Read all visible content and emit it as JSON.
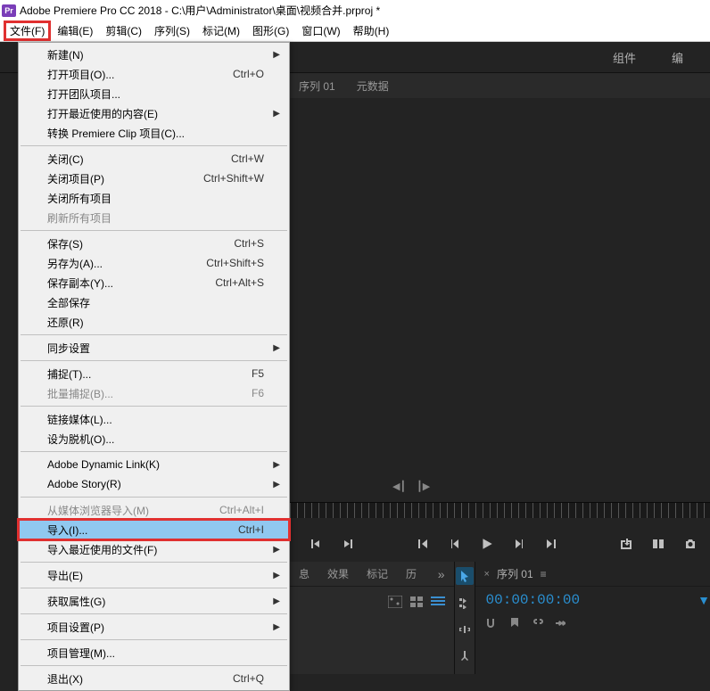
{
  "title": {
    "app_icon": "Pr",
    "text": "Adobe Premiere Pro CC 2018 - C:\\用户\\Administrator\\桌面\\视频合并.prproj *"
  },
  "menu_bar": [
    {
      "label": "文件(F)",
      "highlighted": true
    },
    {
      "label": "编辑(E)"
    },
    {
      "label": "剪辑(C)"
    },
    {
      "label": "序列(S)"
    },
    {
      "label": "标记(M)"
    },
    {
      "label": "图形(G)"
    },
    {
      "label": "窗口(W)"
    },
    {
      "label": "帮助(H)"
    }
  ],
  "workspace_tabs": [
    {
      "label": "组件"
    },
    {
      "label": "编"
    }
  ],
  "panel_tabs": [
    {
      "label": "序列 01"
    },
    {
      "label": "元数据"
    }
  ],
  "lower_tabs": [
    {
      "label": "息"
    },
    {
      "label": "效果"
    },
    {
      "label": "标记"
    },
    {
      "label": "历"
    }
  ],
  "timeline": {
    "title": "序列 01",
    "timecode": "00:00:00:00"
  },
  "dropdown": {
    "items": [
      {
        "type": "item",
        "label": "新建(N)",
        "submenu": true
      },
      {
        "type": "item",
        "label": "打开项目(O)...",
        "shortcut": "Ctrl+O"
      },
      {
        "type": "item",
        "label": "打开团队项目..."
      },
      {
        "type": "item",
        "label": "打开最近使用的内容(E)",
        "submenu": true
      },
      {
        "type": "item",
        "label": "转换 Premiere Clip 项目(C)..."
      },
      {
        "type": "sep"
      },
      {
        "type": "item",
        "label": "关闭(C)",
        "shortcut": "Ctrl+W"
      },
      {
        "type": "item",
        "label": "关闭项目(P)",
        "shortcut": "Ctrl+Shift+W"
      },
      {
        "type": "item",
        "label": "关闭所有项目"
      },
      {
        "type": "item",
        "label": "刷新所有项目",
        "disabled": true
      },
      {
        "type": "sep"
      },
      {
        "type": "item",
        "label": "保存(S)",
        "shortcut": "Ctrl+S"
      },
      {
        "type": "item",
        "label": "另存为(A)...",
        "shortcut": "Ctrl+Shift+S"
      },
      {
        "type": "item",
        "label": "保存副本(Y)...",
        "shortcut": "Ctrl+Alt+S"
      },
      {
        "type": "item",
        "label": "全部保存"
      },
      {
        "type": "item",
        "label": "还原(R)"
      },
      {
        "type": "sep"
      },
      {
        "type": "item",
        "label": "同步设置",
        "submenu": true
      },
      {
        "type": "sep"
      },
      {
        "type": "item",
        "label": "捕捉(T)...",
        "shortcut": "F5"
      },
      {
        "type": "item",
        "label": "批量捕捉(B)...",
        "shortcut": "F6",
        "disabled": true
      },
      {
        "type": "sep"
      },
      {
        "type": "item",
        "label": "链接媒体(L)..."
      },
      {
        "type": "item",
        "label": "设为脱机(O)..."
      },
      {
        "type": "sep"
      },
      {
        "type": "item",
        "label": "Adobe Dynamic Link(K)",
        "submenu": true
      },
      {
        "type": "item",
        "label": "Adobe Story(R)",
        "submenu": true
      },
      {
        "type": "sep"
      },
      {
        "type": "item",
        "label": "从媒体浏览器导入(M)",
        "shortcut": "Ctrl+Alt+I",
        "disabled": true
      },
      {
        "type": "item",
        "label": "导入(I)...",
        "shortcut": "Ctrl+I",
        "highlighted": true,
        "boxed": true
      },
      {
        "type": "item",
        "label": "导入最近使用的文件(F)",
        "submenu": true
      },
      {
        "type": "sep"
      },
      {
        "type": "item",
        "label": "导出(E)",
        "submenu": true
      },
      {
        "type": "sep"
      },
      {
        "type": "item",
        "label": "获取属性(G)",
        "submenu": true
      },
      {
        "type": "sep"
      },
      {
        "type": "item",
        "label": "项目设置(P)",
        "submenu": true
      },
      {
        "type": "sep"
      },
      {
        "type": "item",
        "label": "项目管理(M)..."
      },
      {
        "type": "sep"
      },
      {
        "type": "item",
        "label": "退出(X)",
        "shortcut": "Ctrl+Q"
      }
    ]
  }
}
